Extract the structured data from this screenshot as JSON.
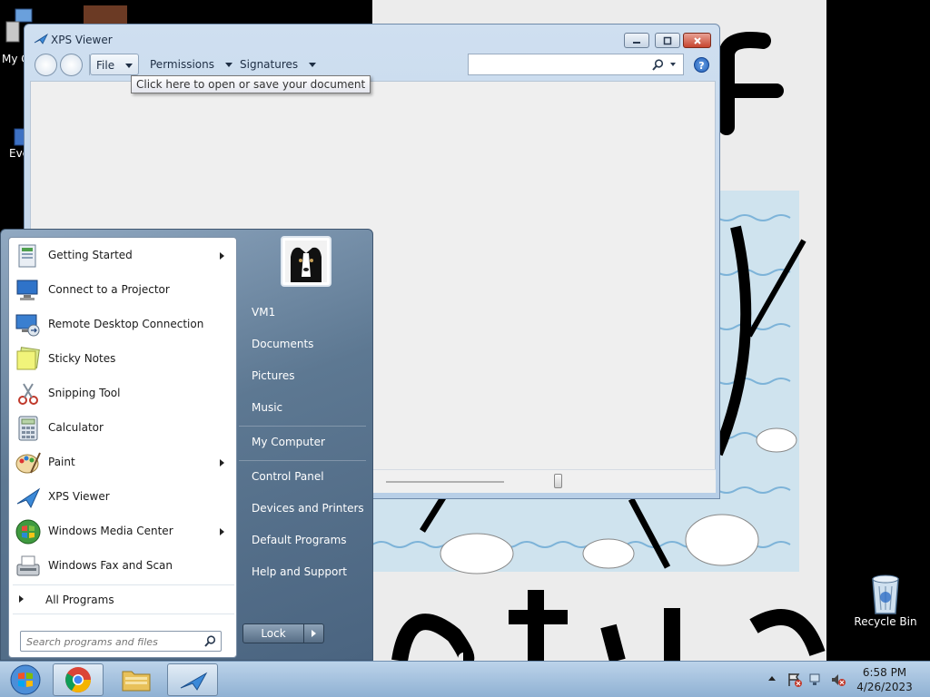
{
  "desktop": {
    "icons": [
      {
        "label": "My C"
      },
      {
        "label": "Eve"
      },
      {
        "label": "Recycle Bin"
      }
    ]
  },
  "xps_window": {
    "title": "XPS Viewer",
    "menu": [
      {
        "label": "File"
      },
      {
        "label": "Permissions"
      },
      {
        "label": "Signatures"
      }
    ],
    "help_label": "?",
    "tooltip": "Click here to open or save your document",
    "search": {
      "value": "",
      "placeholder": ""
    }
  },
  "start_menu": {
    "programs": [
      {
        "label": "Getting Started",
        "has_arrow": true,
        "icon": "getting-started-icon"
      },
      {
        "label": "Connect to a Projector",
        "has_arrow": false,
        "icon": "projector-icon"
      },
      {
        "label": "Remote Desktop Connection",
        "has_arrow": false,
        "icon": "remote-desktop-icon"
      },
      {
        "label": "Sticky Notes",
        "has_arrow": false,
        "icon": "sticky-notes-icon"
      },
      {
        "label": "Snipping Tool",
        "has_arrow": false,
        "icon": "snipping-tool-icon"
      },
      {
        "label": "Calculator",
        "has_arrow": false,
        "icon": "calculator-icon"
      },
      {
        "label": "Paint",
        "has_arrow": true,
        "icon": "paint-icon"
      },
      {
        "label": "XPS Viewer",
        "has_arrow": false,
        "icon": "xps-viewer-icon"
      },
      {
        "label": "Windows Media Center",
        "has_arrow": true,
        "icon": "media-center-icon"
      },
      {
        "label": "Windows Fax and Scan",
        "has_arrow": false,
        "icon": "fax-scan-icon"
      }
    ],
    "all_programs": "All Programs",
    "search_placeholder": "Search programs and files",
    "right_items": [
      {
        "label": "VM1"
      },
      {
        "label": "Documents"
      },
      {
        "label": "Pictures"
      },
      {
        "label": "Music"
      },
      {
        "label": "My Computer"
      },
      {
        "label": "Control Panel"
      },
      {
        "label": "Devices and Printers"
      },
      {
        "label": "Default Programs"
      },
      {
        "label": "Help and Support"
      }
    ],
    "lock_label": "Lock"
  },
  "taskbar": {
    "items": [
      "start-orb-icon",
      "chrome-icon",
      "file-explorer-icon",
      "xps-viewer-icon"
    ],
    "clock_time": "6:58 PM",
    "clock_date": "4/26/2023"
  },
  "colors": {
    "accent": "#1d5db8",
    "start_menu_bg": "#5d7892",
    "taskbar_bg": "#a8c4e0"
  }
}
